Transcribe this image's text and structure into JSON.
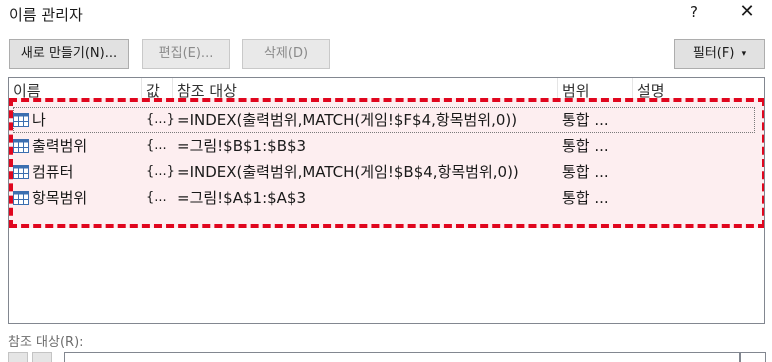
{
  "titlebar": {
    "title": "이름 관리자",
    "help": "?",
    "close": "✕"
  },
  "toolbar": {
    "new_label": "새로 만들기(N)...",
    "edit_label": "편집(E)...",
    "delete_label": "삭제(D)",
    "filter_label": "필터(F)",
    "filter_caret": "▾"
  },
  "list": {
    "columns": {
      "name": "이름",
      "value": "값",
      "refers_to": "참조 대상",
      "scope": "범위",
      "comment": "설명"
    },
    "rows": [
      {
        "name": "나",
        "value": "{...}",
        "refers_to": "=INDEX(출력범위,MATCH(게임!$F$4,항목범위,0))",
        "scope": "통합 ..."
      },
      {
        "name": "출력범위",
        "value": "{...",
        "refers_to": "=그림!$B$1:$B$3",
        "scope": "통합 ..."
      },
      {
        "name": "컴퓨터",
        "value": "{...}",
        "refers_to": "=INDEX(출력범위,MATCH(게임!$B$4,항목범위,0))",
        "scope": "통합 ..."
      },
      {
        "name": "항목범위",
        "value": "{...",
        "refers_to": "=그림!$A$1:$A$3",
        "scope": "통합 ..."
      }
    ]
  },
  "refers_field": {
    "label": "참조 대상(R):"
  },
  "colors": {
    "highlight_border": "#e0061e",
    "highlight_fill": "#fdeef0"
  }
}
